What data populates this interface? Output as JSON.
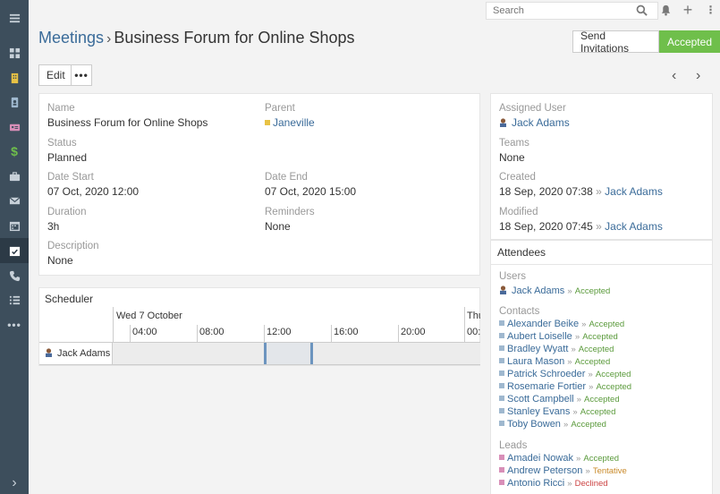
{
  "header": {
    "crumb": "Meetings",
    "separator": "›",
    "title": "Business Forum for Online Shops",
    "send_invitations": "Send Invitations",
    "status_button": "Accepted",
    "edit": "Edit",
    "more": "•••",
    "prev": "‹",
    "next": "›"
  },
  "search": {
    "placeholder": "Search"
  },
  "sidebar": {
    "items": [
      "menu-icon",
      "dashboard-icon",
      "building-icon",
      "contact-book-icon",
      "id-card-icon",
      "dollar-icon",
      "briefcase-icon",
      "envelope-icon",
      "calendar-icon",
      "calendar-check-icon",
      "phone-icon",
      "tasks-icon",
      "more-icon",
      "expand-icon"
    ]
  },
  "details": {
    "name_label": "Name",
    "name": "Business Forum for Online Shops",
    "parent_label": "Parent",
    "parent": "Janeville",
    "status_label": "Status",
    "status": "Planned",
    "date_start_label": "Date Start",
    "date_start": "07 Oct, 2020 12:00",
    "date_end_label": "Date End",
    "date_end": "07 Oct, 2020 15:00",
    "duration_label": "Duration",
    "duration": "3h",
    "reminders_label": "Reminders",
    "reminders": "None",
    "description_label": "Description",
    "description": "None"
  },
  "side": {
    "assigned_label": "Assigned User",
    "assigned": "Jack Adams",
    "teams_label": "Teams",
    "teams": "None",
    "created_label": "Created",
    "created": "18 Sep, 2020 07:38",
    "created_by": "Jack Adams",
    "modified_label": "Modified",
    "modified": "18 Sep, 2020 07:45",
    "modified_by": "Jack Adams",
    "by_sep": "»"
  },
  "scheduler": {
    "title": "Scheduler",
    "date": "Wed 7 October",
    "date_next": "Thu",
    "hours": [
      "04:00",
      "08:00",
      "12:00",
      "16:00",
      "20:00",
      "00:"
    ],
    "row_user": "Jack Adams"
  },
  "attendees": {
    "title": "Attendees",
    "users_label": "Users",
    "users": [
      {
        "name": "Jack Adams",
        "status": "Accepted"
      }
    ],
    "contacts_label": "Contacts",
    "contacts": [
      {
        "name": "Alexander Beike",
        "status": "Accepted"
      },
      {
        "name": "Aubert Loiselle",
        "status": "Accepted"
      },
      {
        "name": "Bradley Wyatt",
        "status": "Accepted"
      },
      {
        "name": "Laura Mason",
        "status": "Accepted"
      },
      {
        "name": "Patrick Schroeder",
        "status": "Accepted"
      },
      {
        "name": "Rosemarie Fortier",
        "status": "Accepted"
      },
      {
        "name": "Scott Campbell",
        "status": "Accepted"
      },
      {
        "name": "Stanley Evans",
        "status": "Accepted"
      },
      {
        "name": "Toby Bowen",
        "status": "Accepted"
      }
    ],
    "leads_label": "Leads",
    "leads": [
      {
        "name": "Amadei Nowak",
        "status": "Accepted"
      },
      {
        "name": "Andrew Peterson",
        "status": "Tentative"
      },
      {
        "name": "Antonio Ricci",
        "status": "Declined"
      }
    ]
  },
  "colors": {
    "sidebar": "#3d4e5c",
    "accent_link": "#3a6b99",
    "accepted": "#6fbf4b",
    "account_square": "#e8c245",
    "contact_square": "#9fb8cf",
    "lead_square": "#d88fb8"
  }
}
